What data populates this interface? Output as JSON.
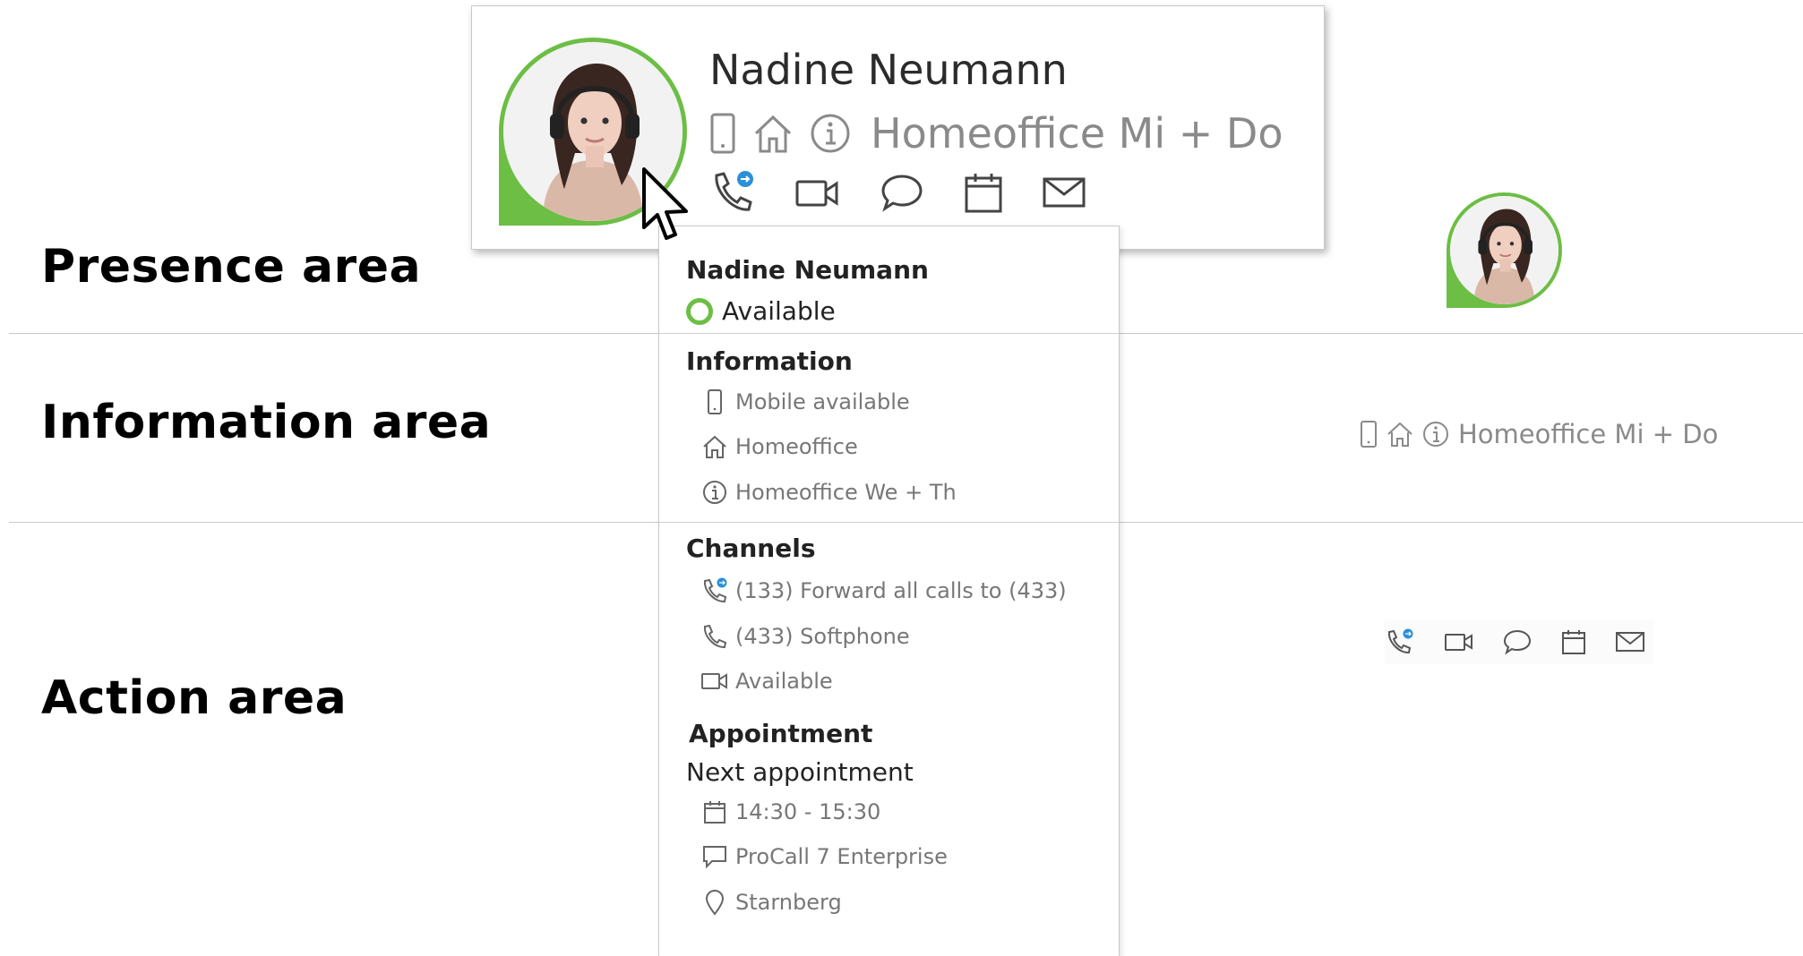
{
  "labels": {
    "presence": "Presence area",
    "information": "Information area",
    "action": "Action area"
  },
  "card": {
    "name": "Nadine Neumann",
    "info_text": "Homeoffice Mi + Do",
    "icons": [
      "mobile-icon",
      "home-icon",
      "info-icon"
    ],
    "actions": [
      "phone-forward-icon",
      "video-icon",
      "chat-icon",
      "calendar-icon",
      "mail-icon"
    ]
  },
  "tooltip": {
    "name": "Nadine Neumann",
    "status": "Available",
    "information": {
      "heading": "Information",
      "items": [
        "Mobile available",
        "Homeoffice",
        "Homeoffice We + Th"
      ]
    },
    "channels": {
      "heading": "Channels",
      "items": [
        "(133) Forward all calls to (433)",
        "(433) Softphone",
        "Available"
      ]
    },
    "appointment": {
      "heading": "Appointment",
      "next_label": "Next appointment",
      "items": [
        "14:30 - 15:30",
        "ProCall 7 Enterprise",
        "Starnberg"
      ]
    }
  },
  "mini": {
    "info_text": "Homeoffice Mi + Do"
  },
  "colors": {
    "presence_green": "#6cbe45",
    "forward_blue": "#2d8fd5",
    "icon_gray": "#666666",
    "text_gray": "#8a8a8a"
  }
}
